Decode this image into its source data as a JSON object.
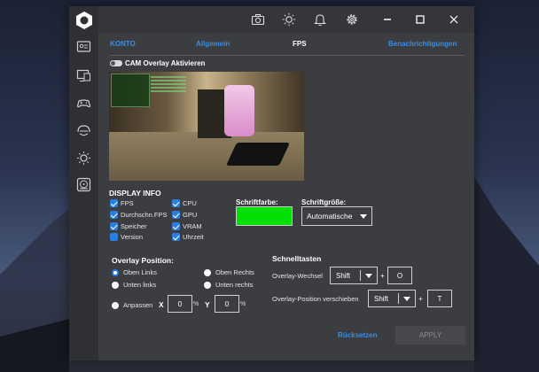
{
  "titlebar": {
    "icons": [
      "camera-icon",
      "brightness-icon",
      "bell-icon",
      "gear-icon",
      "minimize-icon",
      "maximize-icon",
      "close-icon"
    ]
  },
  "sidebar": {
    "icons": [
      "id-card-icon",
      "monitor-icon",
      "gamepad-icon",
      "headset-icon",
      "brightness-icon",
      "disk-icon"
    ]
  },
  "tabs": {
    "konto": "KONTO",
    "allgemein": "Allgemein",
    "fps": "FPS",
    "benachrichtigungen": "Benachrichtigungen"
  },
  "cam_overlay": {
    "label": "CAM Overlay Aktivieren",
    "enabled": false
  },
  "display_info": {
    "title": "DISPLAY INFO",
    "items": [
      {
        "label": "FPS",
        "checked": true
      },
      {
        "label": "Durchschn.FPS",
        "checked": true
      },
      {
        "label": "Speicher",
        "checked": true
      },
      {
        "label": "Version",
        "checked": false
      },
      {
        "label": "CPU",
        "checked": true
      },
      {
        "label": "GPU",
        "checked": true
      },
      {
        "label": "VRAM",
        "checked": true
      },
      {
        "label": "Uhrzeit",
        "checked": true
      }
    ]
  },
  "font_color": {
    "label": "Schriftfarbe:",
    "value": "#00e000"
  },
  "font_size": {
    "label": "Schriftgröße:",
    "value": "Automatische"
  },
  "overlay_position": {
    "title": "Overlay Position:",
    "options": {
      "top_left": "Oben Links",
      "top_right": "Oben Rechts",
      "bottom_left": "Unten links",
      "bottom_right": "Unten rechts",
      "custom": "Anpassen"
    },
    "selected": "top_left",
    "x_label": "X",
    "y_label": "Y",
    "x_value": "0",
    "y_value": "0",
    "unit": "%"
  },
  "hotkeys": {
    "title": "Schnelltasten",
    "overlay_toggle": {
      "label": "Overlay-Wechsel",
      "modifier": "Shift",
      "plus": "+",
      "key": "O"
    },
    "overlay_move": {
      "label": "Overlay-Position verschieben",
      "modifier": "Shift",
      "plus": "+",
      "key": "T"
    }
  },
  "actions": {
    "reset": "Rücksetzen",
    "apply": "APPLY"
  },
  "colors": {
    "accent": "#2a7de1",
    "link": "#3a8ee6",
    "panel": "#3b3d40",
    "sidebar": "#2e3033"
  }
}
